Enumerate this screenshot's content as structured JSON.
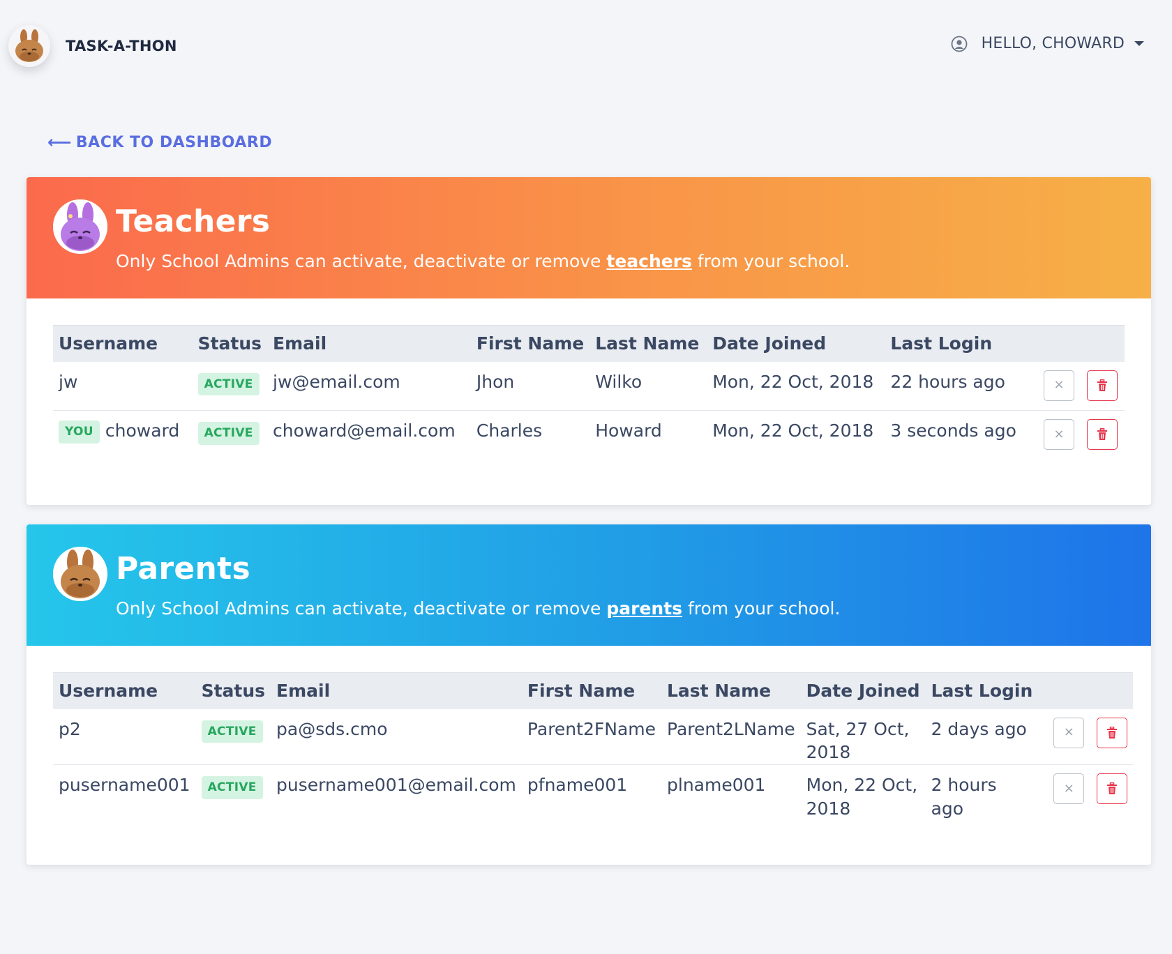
{
  "app": {
    "title": "TASK-A-THON",
    "user_greeting": "HELLO, CHOWARD"
  },
  "nav": {
    "back_label": "BACK TO DASHBOARD",
    "back_arrow": "⟵"
  },
  "teachers": {
    "title": "Teachers",
    "subtitle_pre": "Only School Admins can activate, deactivate or remove ",
    "subtitle_highlight": "teachers",
    "subtitle_post": " from your school.",
    "columns": [
      "Username",
      "Status",
      "Email",
      "First Name",
      "Last Name",
      "Date Joined",
      "Last Login"
    ],
    "rows": [
      {
        "you": "",
        "username": "jw",
        "status": "ACTIVE",
        "email": "jw@email.com",
        "first_name": "Jhon",
        "last_name": "Wilko",
        "date_joined": "Mon, 22 Oct, 2018",
        "last_login": "22 hours ago"
      },
      {
        "you": "YOU",
        "username": "choward",
        "status": "ACTIVE",
        "email": "choward@email.com",
        "first_name": "Charles",
        "last_name": "Howard",
        "date_joined": "Mon, 22 Oct, 2018",
        "last_login": "3 seconds ago"
      }
    ]
  },
  "parents": {
    "title": "Parents",
    "subtitle_pre": "Only School Admins can activate, deactivate or remove ",
    "subtitle_highlight": "parents",
    "subtitle_post": " from your school.",
    "columns": [
      "Username",
      "Status",
      "Email",
      "First Name",
      "Last Name",
      "Date Joined",
      "Last Login"
    ],
    "rows": [
      {
        "username": "p2",
        "status": "ACTIVE",
        "email": "pa@sds.cmo",
        "first_name": "Parent2FName",
        "last_name": "Parent2LName",
        "date_joined": "Sat, 27 Oct, 2018",
        "last_login": "2 days ago"
      },
      {
        "username": "pusername001",
        "status": "ACTIVE",
        "email": "pusername001@email.com",
        "first_name": "pfname001",
        "last_name": "plname001",
        "date_joined": "Mon, 22 Oct, 2018",
        "last_login": "2 hours ago"
      }
    ]
  },
  "icons": {
    "deactivate": "×",
    "delete": "trash-icon",
    "user": "user-circle-icon"
  },
  "colors": {
    "teachers_gradient": [
      "#fb6a4c",
      "#f6b047"
    ],
    "parents_gradient": [
      "#25c6ea",
      "#1e74e8"
    ],
    "active_badge_bg": "#d5f3e2",
    "active_badge_text": "#27a75f",
    "delete_red": "#e8364d",
    "link_blue": "#5a6ee0"
  }
}
